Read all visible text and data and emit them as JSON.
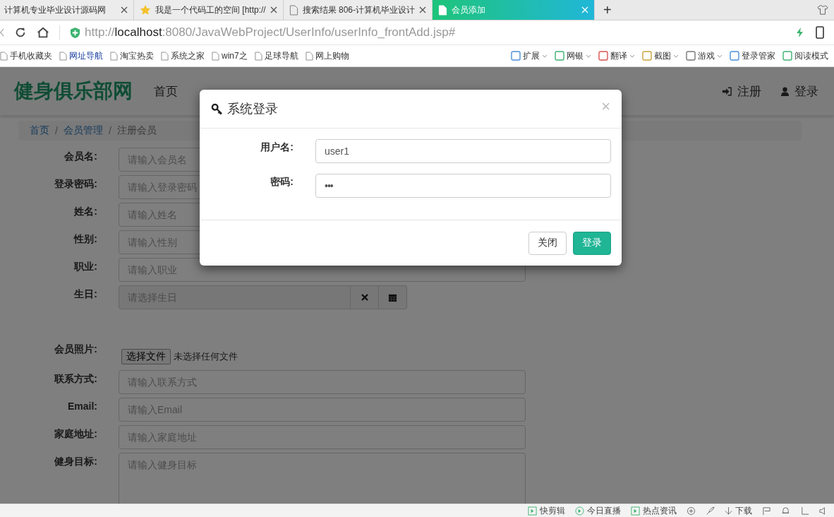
{
  "browser": {
    "tabs": [
      {
        "title": "计算机专业毕业设计源码网",
        "kind": "plain",
        "selected": false
      },
      {
        "title": "我是一个代码工的空间 [http://",
        "kind": "favorite",
        "selected": false
      },
      {
        "title": "搜索结果 806-计算机毕业设计",
        "kind": "page",
        "selected": false
      },
      {
        "title": "会员添加",
        "kind": "page",
        "selected": true
      }
    ],
    "new_tab": "+",
    "url": {
      "scheme": "http://",
      "host": "localhost",
      "rest": ":8080/JavaWebProject/UserInfo/userInfo_frontAdd.jsp#"
    },
    "bookmarks": [
      "手机收藏夹",
      "网址导航",
      "淘宝热卖",
      "系统之家",
      "win7之",
      "足球导航",
      "网上购物"
    ],
    "tools": [
      "扩展",
      "网银",
      "翻译",
      "截图",
      "游戏",
      "登录管家",
      "阅读模式"
    ]
  },
  "site": {
    "brand": "健身俱乐部网",
    "nav": [
      "首页"
    ],
    "actions": [
      {
        "label": "注册",
        "kind": "signin"
      },
      {
        "label": "登录",
        "kind": "user"
      }
    ],
    "breadcrumb_separator": "/",
    "breadcrumb": [
      {
        "label": "首页",
        "link": true
      },
      {
        "label": "会员管理",
        "link": true
      },
      {
        "label": "注册会员",
        "link": false
      }
    ],
    "fields": [
      {
        "label": "会员名:",
        "kind": "input",
        "placeholder": "请输入会员名"
      },
      {
        "label": "登录密码:",
        "kind": "input",
        "placeholder": "请输入登录密码"
      },
      {
        "label": "姓名:",
        "kind": "input",
        "placeholder": "请输入姓名"
      },
      {
        "label": "性别:",
        "kind": "input",
        "placeholder": "请输入性别"
      },
      {
        "label": "职业:",
        "kind": "input",
        "placeholder": "请输入职业"
      },
      {
        "label": "生日:",
        "kind": "date",
        "placeholder": "请选择生日"
      },
      {
        "label": "会员照片:",
        "kind": "file",
        "button": "选择文件",
        "note": "未选择任何文件"
      },
      {
        "label": "联系方式:",
        "kind": "input",
        "placeholder": "请输入联系方式"
      },
      {
        "label": "Email:",
        "kind": "input",
        "placeholder": "请输入Email"
      },
      {
        "label": "家庭地址:",
        "kind": "input",
        "placeholder": "请输入家庭地址"
      },
      {
        "label": "健身目标:",
        "kind": "textarea",
        "placeholder": "请输入健身目标"
      }
    ]
  },
  "modal": {
    "title": "系统登录",
    "close": "×",
    "fields": [
      {
        "label": "用户名:",
        "value": "user1",
        "kind": "text"
      },
      {
        "label": "密码:",
        "value": "•••",
        "kind": "password"
      }
    ],
    "buttons": [
      {
        "label": "关闭",
        "kind": "default"
      },
      {
        "label": "登录",
        "kind": "primary"
      }
    ]
  },
  "status_bar": {
    "items": [
      "快剪辑",
      "今日直播",
      "热点资讯"
    ],
    "download": "下载"
  }
}
